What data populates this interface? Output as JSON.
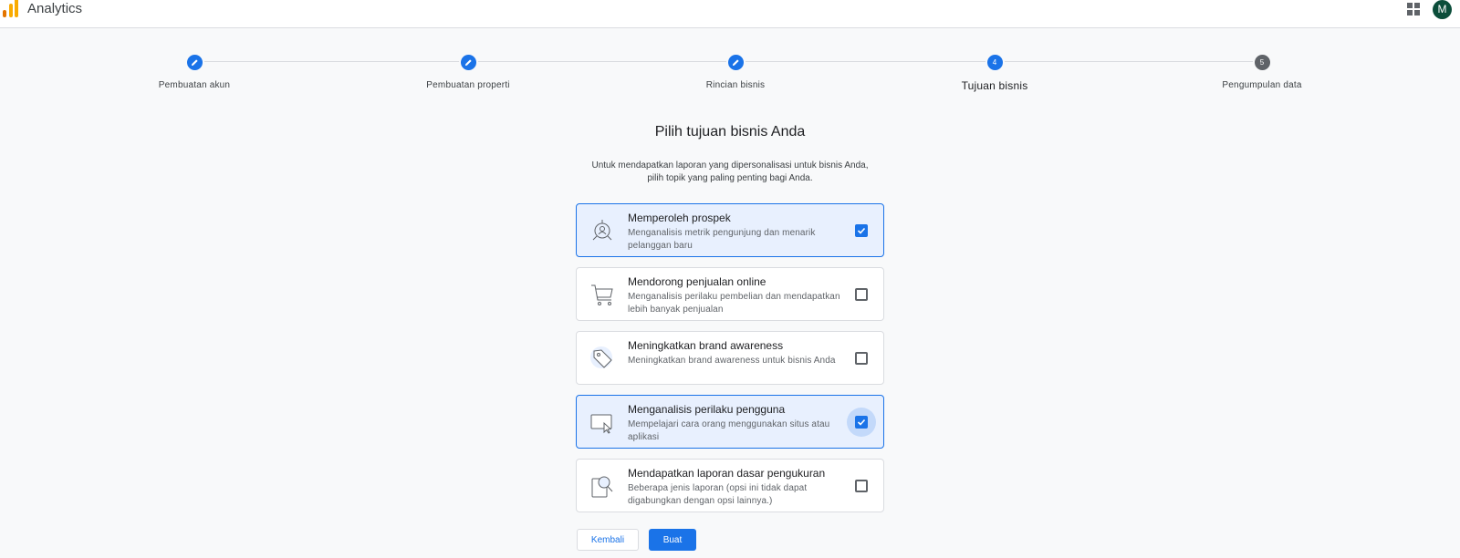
{
  "app": {
    "title": "Analytics",
    "avatar_initial": "M"
  },
  "colors": {
    "accent": "#1a73e8",
    "selected_bg": "#e8f0fe",
    "avatar_bg": "#0b4d3a",
    "logo_orange": "#f9ab00",
    "logo_dark": "#e37400"
  },
  "steps": [
    {
      "label": "Pembuatan akun",
      "state": "done",
      "icon": "pencil-icon"
    },
    {
      "label": "Pembuatan properti",
      "state": "done",
      "icon": "pencil-icon"
    },
    {
      "label": "Rincian bisnis",
      "state": "done",
      "icon": "pencil-icon"
    },
    {
      "label": "Tujuan bisnis",
      "state": "current",
      "number": "4"
    },
    {
      "label": "Pengumpulan data",
      "state": "todo",
      "number": "5"
    }
  ],
  "heading": "Pilih tujuan bisnis Anda",
  "subheading_line1": "Untuk mendapatkan laporan yang dipersonalisasi untuk bisnis Anda,",
  "subheading_line2": "pilih topik yang paling penting bagi Anda.",
  "options": [
    {
      "title": "Memperoleh prospek",
      "desc": "Menganalisis metrik pengunjung dan menarik pelanggan baru",
      "checked": true,
      "icon": "target-person-icon"
    },
    {
      "title": "Mendorong penjualan online",
      "desc": "Menganalisis perilaku pembelian dan mendapatkan lebih banyak penjualan",
      "checked": false,
      "icon": "cart-icon"
    },
    {
      "title": "Meningkatkan brand awareness",
      "desc": "Meningkatkan brand awareness untuk bisnis Anda",
      "checked": false,
      "icon": "tag-icon"
    },
    {
      "title": "Menganalisis perilaku pengguna",
      "desc": "Mempelajari cara orang menggunakan situs atau aplikasi",
      "checked": true,
      "icon": "screen-cursor-icon"
    },
    {
      "title": "Mendapatkan laporan dasar pengukuran",
      "desc": "Beberapa jenis laporan (opsi ini tidak dapat digabungkan dengan opsi lainnya.)",
      "checked": false,
      "icon": "report-magnifier-icon"
    }
  ],
  "buttons": {
    "back": "Kembali",
    "create": "Buat"
  }
}
